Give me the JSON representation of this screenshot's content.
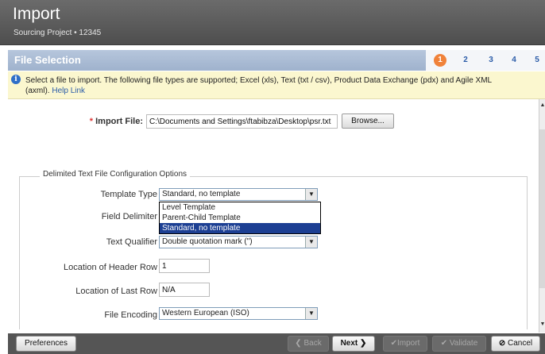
{
  "header": {
    "title": "Import",
    "subtitle": "Sourcing Project • 12345"
  },
  "stepbar": {
    "label": "File Selection",
    "steps": [
      "1",
      "2",
      "3",
      "4",
      "5"
    ],
    "active_step": "1"
  },
  "info": {
    "text": "Select a file to import. The following file types are supported; Excel (xls), Text (txt / csv), Product Data Exchange (pdx) and Agile XML (axml).",
    "help_link": "Help Link"
  },
  "import_file": {
    "required_mark": "*",
    "label": "Import File:",
    "value": "C:\\Documents and Settings\\ftabibza\\Desktop\\psr.txt",
    "browse_label": "Browse..."
  },
  "config": {
    "legend": "Delimited Text File Configuration Options",
    "template_type": {
      "label": "Template Type",
      "value": "Standard, no template",
      "options": [
        "Level Template",
        "Parent-Child Template",
        "Standard, no template"
      ]
    },
    "field_delimiter": {
      "label": "Field Delimiter"
    },
    "text_qualifier": {
      "label": "Text Qualifier",
      "value": "Double quotation mark (\")"
    },
    "header_row": {
      "label": "Location of Header Row",
      "value": "1"
    },
    "last_row": {
      "label": "Location of Last Row",
      "value": "N/A"
    },
    "file_encoding": {
      "label": "File Encoding",
      "value": "Western European (ISO)"
    }
  },
  "footer": {
    "preferences": "Preferences",
    "back": "Back",
    "next": "Next",
    "import": "Import",
    "validate": "Validate",
    "cancel": "Cancel"
  },
  "colors": {
    "accent_orange": "#f0823a",
    "link_blue": "#2b5ca8",
    "info_bg": "#fbf7cf",
    "header_bg": "#5a5a5a"
  }
}
